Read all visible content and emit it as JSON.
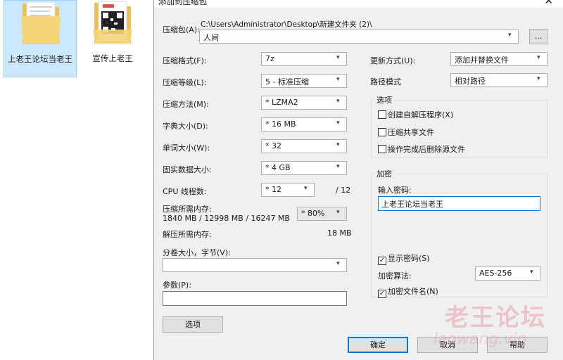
{
  "desktop": {
    "icons": [
      {
        "label": "上老王论坛当老王"
      },
      {
        "label": "宣传上老王"
      }
    ]
  },
  "dialog": {
    "title": "添加到压缩包",
    "close_glyph": "✕"
  },
  "archive": {
    "label": "压缩包(A):",
    "path": "C:\\Users\\Administrator\\Desktop\\新建文件夹 (2)\\",
    "name": "人间",
    "browse_label": "..."
  },
  "left": {
    "format_label": "压缩格式(F):",
    "format_value": "7z",
    "level_label": "压缩等级(L):",
    "level_value": "5 - 标准压缩",
    "method_label": "压缩方法(M):",
    "method_value": "* LZMA2",
    "dict_label": "字典大小(D):",
    "dict_value": "* 16 MB",
    "word_label": "单词大小(W):",
    "word_value": "* 32",
    "solid_label": "固实数据大小:",
    "solid_value": "* 4 GB",
    "cpu_label": "CPU 线程数:",
    "cpu_value": "* 12",
    "cpu_total": "/ 12",
    "mem_label": "压缩所需内存:",
    "mem_value": "1840 MB / 12998 MB / 16247 MB",
    "mem_pct": "* 80%",
    "decomp_label": "解压所需内存:",
    "decomp_value": "18 MB",
    "volume_label": "分卷大小，字节(V):",
    "volume_value": "",
    "params_label": "参数(P):",
    "params_value": "",
    "options_button": "选项"
  },
  "right": {
    "update_label": "更新方式(U):",
    "update_value": "添加并替换文件",
    "path_label": "路径模式",
    "path_value": "相对路径",
    "options_group": "选项",
    "opt_sfx": "创建自解压程序(X)",
    "opt_shared": "压缩共享文件",
    "opt_delete": "操作完成后删除源文件",
    "enc_group": "加密",
    "enc_pwd_label": "输入密码:",
    "enc_pwd_value": "上老王论坛当老王",
    "show_pwd": "显示密码(S)",
    "check_mark": "✓",
    "enc_method_label": "加密算法:",
    "enc_method_value": "AES-256",
    "enc_names": "加密文件名(N)"
  },
  "buttons": {
    "ok": "确定",
    "cancel": "取消",
    "help": "帮助"
  },
  "watermark": {
    "text": "老王论坛",
    "url": "laowang.vip"
  },
  "colors": {
    "accent": "#0078d7",
    "selection": "#cce8ff",
    "folder": "#f5d57a"
  }
}
